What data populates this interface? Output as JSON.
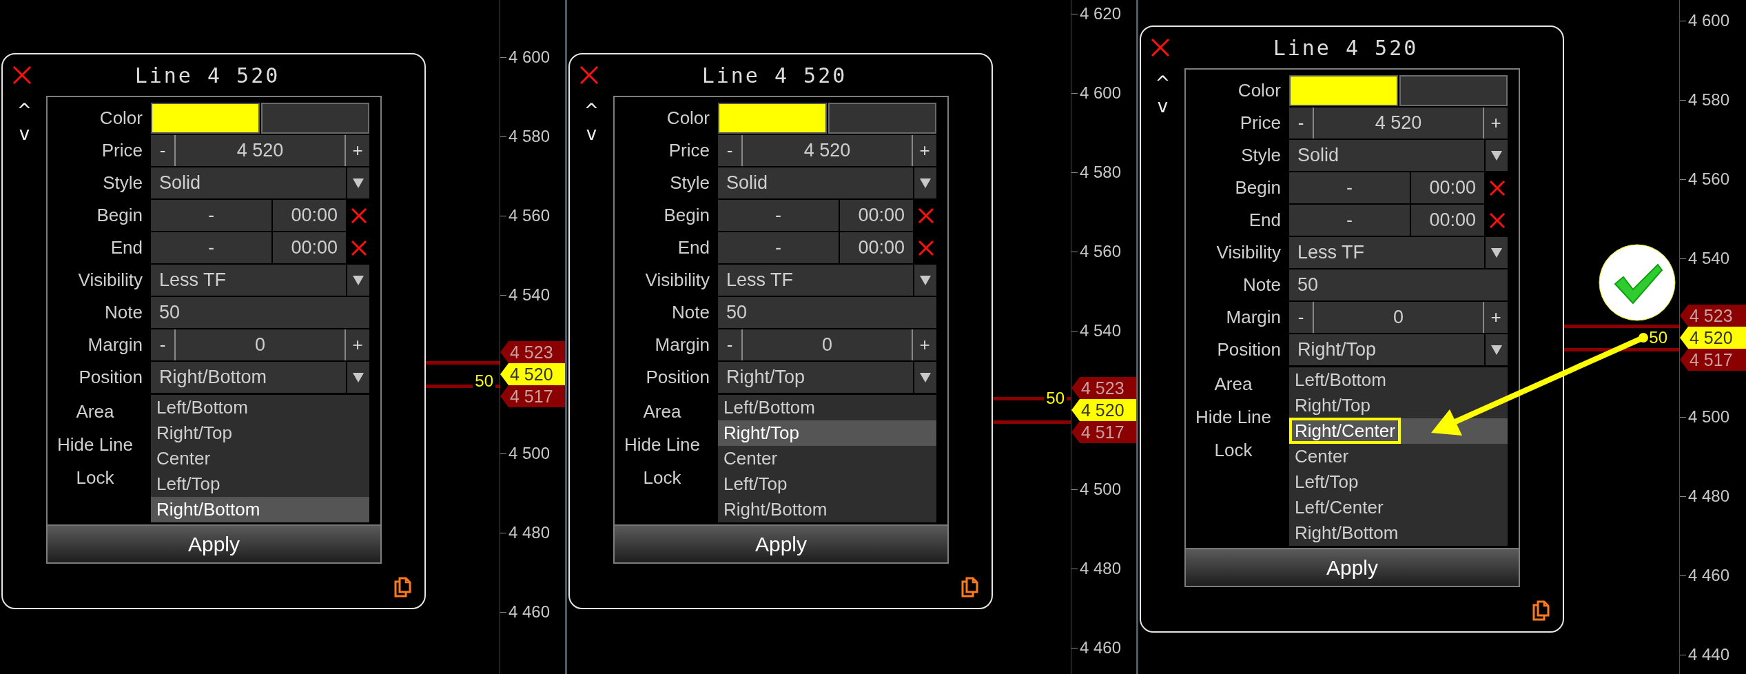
{
  "sections": [
    {
      "panel": {
        "title": "Line 4 520",
        "up": "^",
        "down": "v",
        "fields": [
          {
            "kind": "color",
            "label": "Color",
            "color": "#ffff00"
          },
          {
            "kind": "stepper",
            "label": "Price",
            "minus": "-",
            "value": "4 520",
            "plus": "+"
          },
          {
            "kind": "dropdown",
            "label": "Style",
            "value": "Solid"
          },
          {
            "kind": "time",
            "label": "Begin",
            "date": "-",
            "time": "00:00"
          },
          {
            "kind": "time",
            "label": "End",
            "date": "-",
            "time": "00:00"
          },
          {
            "kind": "dropdown",
            "label": "Visibility",
            "value": "Less TF"
          },
          {
            "kind": "text",
            "label": "Note",
            "value": "50"
          },
          {
            "kind": "stepper",
            "label": "Margin",
            "minus": "-",
            "value": "0",
            "plus": "+"
          },
          {
            "kind": "dropdown",
            "label": "Position",
            "value": "Right/Bottom"
          }
        ],
        "covered_labels": [
          "Area",
          "Hide Line",
          "Lock"
        ],
        "options": [
          {
            "label": "Left/Bottom",
            "selected": false,
            "highlighted": false
          },
          {
            "label": "Right/Top",
            "selected": false,
            "highlighted": false
          },
          {
            "label": "Center",
            "selected": false,
            "highlighted": false
          },
          {
            "label": "Left/Top",
            "selected": false,
            "highlighted": false
          },
          {
            "label": "Right/Bottom",
            "selected": true,
            "highlighted": false
          }
        ],
        "apply": "Apply"
      },
      "chart": {
        "note": "50",
        "upper_tag": "4 523",
        "current_tag": "4 520",
        "lower_tag": "4 517",
        "arrow": false,
        "check": false,
        "axis": [
          "4 600",
          "4 580",
          "4 560",
          "4 540",
          "4 500",
          "4 480",
          "4 460"
        ]
      }
    },
    {
      "panel": {
        "title": "Line 4 520",
        "up": "^",
        "down": "v",
        "fields": [
          {
            "kind": "color",
            "label": "Color",
            "color": "#ffff00"
          },
          {
            "kind": "stepper",
            "label": "Price",
            "minus": "-",
            "value": "4 520",
            "plus": "+"
          },
          {
            "kind": "dropdown",
            "label": "Style",
            "value": "Solid"
          },
          {
            "kind": "time",
            "label": "Begin",
            "date": "-",
            "time": "00:00"
          },
          {
            "kind": "time",
            "label": "End",
            "date": "-",
            "time": "00:00"
          },
          {
            "kind": "dropdown",
            "label": "Visibility",
            "value": "Less TF"
          },
          {
            "kind": "text",
            "label": "Note",
            "value": "50"
          },
          {
            "kind": "stepper",
            "label": "Margin",
            "minus": "-",
            "value": "0",
            "plus": "+"
          },
          {
            "kind": "dropdown",
            "label": "Position",
            "value": "Right/Top"
          }
        ],
        "covered_labels": [
          "Area",
          "Hide Line",
          "Lock"
        ],
        "options": [
          {
            "label": "Left/Bottom",
            "selected": false,
            "highlighted": false
          },
          {
            "label": "Right/Top",
            "selected": true,
            "highlighted": false
          },
          {
            "label": "Center",
            "selected": false,
            "highlighted": false
          },
          {
            "label": "Left/Top",
            "selected": false,
            "highlighted": false
          },
          {
            "label": "Right/Bottom",
            "selected": false,
            "highlighted": false
          }
        ],
        "apply": "Apply"
      },
      "chart": {
        "note": "50",
        "upper_tag": "4 523",
        "current_tag": "4 520",
        "lower_tag": "4 517",
        "arrow": false,
        "check": false,
        "axis": [
          "4 620",
          "4 600",
          "4 580",
          "4 560",
          "4 540",
          "4 500",
          "4 480",
          "4 460"
        ]
      }
    },
    {
      "panel": {
        "title": "Line 4 520",
        "up": "^",
        "down": "v",
        "fields": [
          {
            "kind": "color",
            "label": "Color",
            "color": "#ffff00"
          },
          {
            "kind": "stepper",
            "label": "Price",
            "minus": "-",
            "value": "4 520",
            "plus": "+"
          },
          {
            "kind": "dropdown",
            "label": "Style",
            "value": "Solid"
          },
          {
            "kind": "time",
            "label": "Begin",
            "date": "-",
            "time": "00:00"
          },
          {
            "kind": "time",
            "label": "End",
            "date": "-",
            "time": "00:00"
          },
          {
            "kind": "dropdown",
            "label": "Visibility",
            "value": "Less TF"
          },
          {
            "kind": "text",
            "label": "Note",
            "value": "50"
          },
          {
            "kind": "stepper",
            "label": "Margin",
            "minus": "-",
            "value": "0",
            "plus": "+"
          },
          {
            "kind": "dropdown",
            "label": "Position",
            "value": "Right/Top"
          }
        ],
        "covered_labels": [
          "Area",
          "Hide Line",
          "Lock"
        ],
        "options": [
          {
            "label": "Left/Bottom",
            "selected": false,
            "highlighted": false
          },
          {
            "label": "Right/Top",
            "selected": false,
            "highlighted": false
          },
          {
            "label": "Right/Center",
            "selected": true,
            "highlighted": true
          },
          {
            "label": "Center",
            "selected": false,
            "highlighted": false
          },
          {
            "label": "Left/Top",
            "selected": false,
            "highlighted": false
          },
          {
            "label": "Left/Center",
            "selected": false,
            "highlighted": false
          },
          {
            "label": "Right/Bottom",
            "selected": false,
            "highlighted": false
          }
        ],
        "apply": "Apply"
      },
      "chart": {
        "note": "50",
        "upper_tag": "4 523",
        "current_tag": "4 520",
        "lower_tag": "4 517",
        "arrow": true,
        "check": true,
        "axis": [
          "4 600",
          "4 580",
          "4 560",
          "4 540",
          "4 500",
          "4 480",
          "4 460",
          "4 440"
        ]
      }
    }
  ]
}
